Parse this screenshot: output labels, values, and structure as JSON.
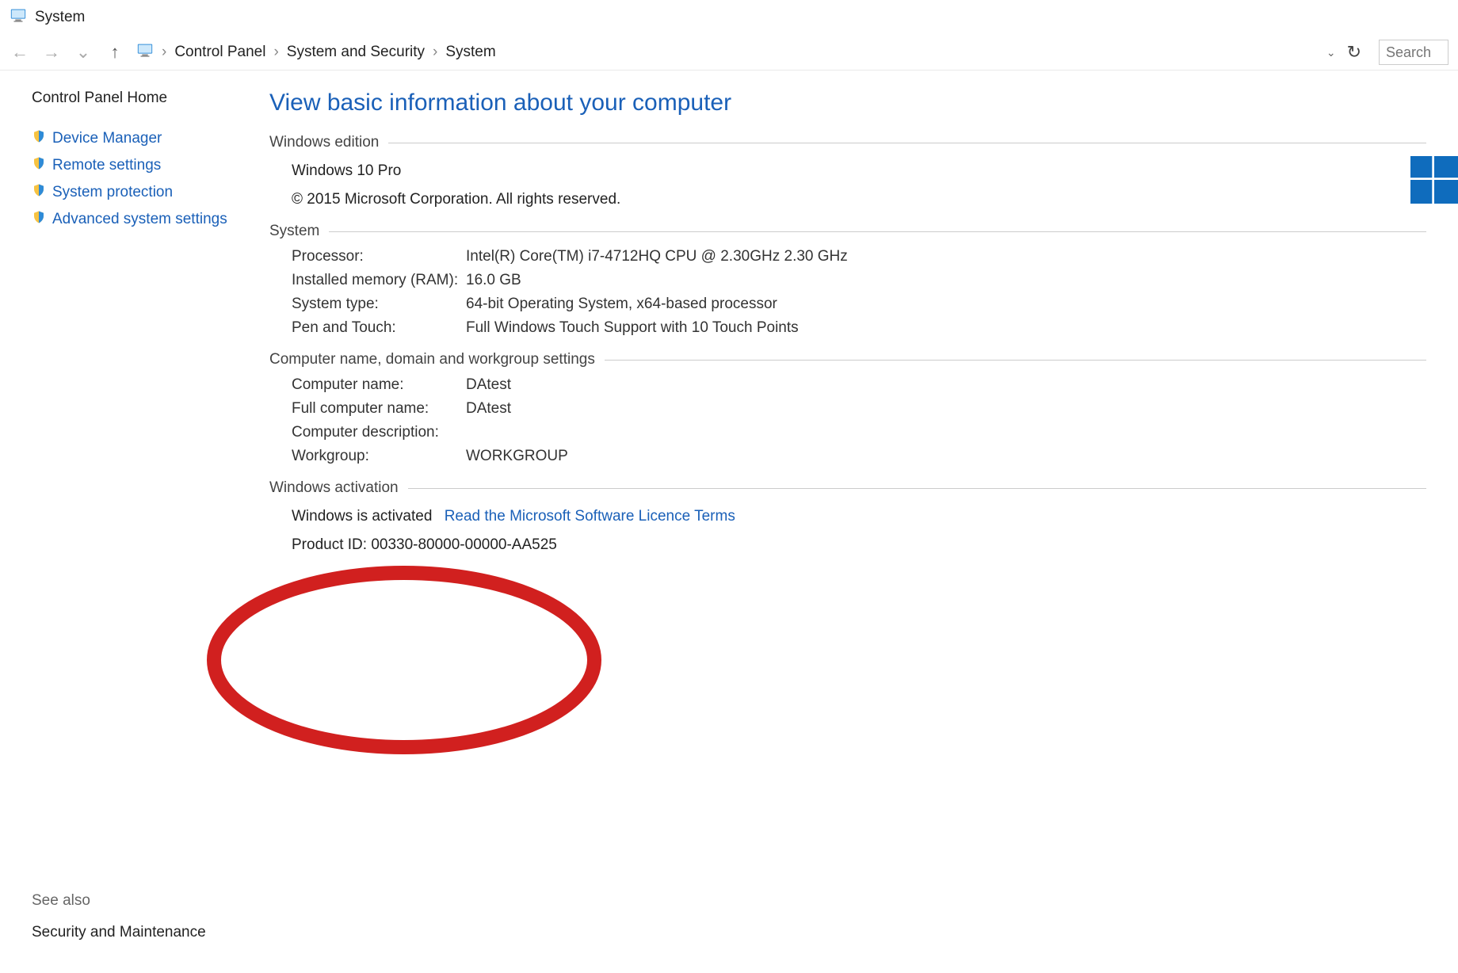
{
  "window": {
    "title": "System"
  },
  "breadcrumb": {
    "items": [
      "Control Panel",
      "System and Security",
      "System"
    ],
    "search_placeholder": "Search"
  },
  "sidebar": {
    "home": "Control Panel Home",
    "links": [
      "Device Manager",
      "Remote settings",
      "System protection",
      "Advanced system settings"
    ],
    "see_also_heading": "See also",
    "see_also_links": [
      "Security and Maintenance"
    ]
  },
  "page": {
    "heading": "View basic information about your computer",
    "sections": {
      "edition": {
        "title": "Windows edition",
        "edition_name": "Windows 10 Pro",
        "copyright": "© 2015 Microsoft Corporation. All rights reserved."
      },
      "system": {
        "title": "System",
        "rows": {
          "processor_label": "Processor:",
          "processor_value": "Intel(R) Core(TM) i7-4712HQ CPU @ 2.30GHz   2.30 GHz",
          "ram_label": "Installed memory (RAM):",
          "ram_value": "16.0 GB",
          "type_label": "System type:",
          "type_value": "64-bit Operating System, x64-based processor",
          "pen_label": "Pen and Touch:",
          "pen_value": "Full Windows Touch Support with 10 Touch Points"
        }
      },
      "computer": {
        "title": "Computer name, domain and workgroup settings",
        "rows": {
          "name_label": "Computer name:",
          "name_value": "DAtest",
          "full_label": "Full computer name:",
          "full_value": "DAtest",
          "desc_label": "Computer description:",
          "desc_value": "",
          "wg_label": "Workgroup:",
          "wg_value": "WORKGROUP"
        }
      },
      "activation": {
        "title": "Windows activation",
        "status": "Windows is activated",
        "licence_link": "Read the Microsoft Software Licence Terms",
        "product_id_text": "Product ID: 00330-80000-00000-AA525"
      }
    }
  },
  "colors": {
    "accent": "#1a60b8",
    "annotation": "#d1201f"
  }
}
